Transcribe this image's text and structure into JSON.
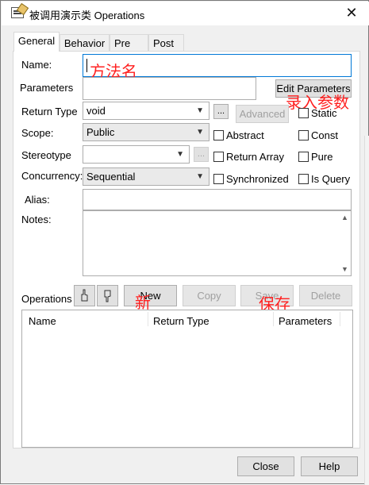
{
  "window": {
    "title": "被调用演示类 Operations",
    "icon": "class-edit-icon"
  },
  "tabs": [
    {
      "label": "General",
      "active": true
    },
    {
      "label": "Behavior",
      "active": false
    },
    {
      "label": "Pre",
      "active": false
    },
    {
      "label": "Post",
      "active": false
    }
  ],
  "form": {
    "name_label": "Name:",
    "name_value": "",
    "parameters_label": "Parameters",
    "edit_parameters_label": "Edit Parameters",
    "return_type_label": "Return Type",
    "return_type_value": "void",
    "browse_label": "...",
    "advanced_label": "Advanced",
    "scope_label": "Scope:",
    "scope_value": "Public",
    "stereotype_label": "Stereotype",
    "stereotype_value": "",
    "concurrency_label": "Concurrency:",
    "concurrency_value": "Sequential",
    "alias_label": "Alias:",
    "notes_label": "Notes:"
  },
  "checkboxes": {
    "static": {
      "label": "Static",
      "checked": false
    },
    "abstract": {
      "label": "Abstract",
      "checked": false
    },
    "const": {
      "label": "Const",
      "checked": false
    },
    "return_array": {
      "label": "Return Array",
      "checked": false
    },
    "pure": {
      "label": "Pure",
      "checked": false
    },
    "synchronized": {
      "label": "Synchronized",
      "checked": false
    },
    "is_query": {
      "label": "Is Query",
      "checked": false
    }
  },
  "operations": {
    "label": "Operations",
    "new_label": "New",
    "copy_label": "Copy",
    "save_label": "Save",
    "delete_label": "Delete",
    "columns": [
      "Name",
      "Return Type",
      "Parameters"
    ],
    "rows": []
  },
  "footer": {
    "close_label": "Close",
    "help_label": "Help"
  },
  "annotations": {
    "method_name": "方法名",
    "enter_params": "录入参数",
    "new": "新",
    "save": "保存"
  },
  "colors": {
    "annotation": "#ff2020",
    "focus_border": "#0078d7"
  }
}
